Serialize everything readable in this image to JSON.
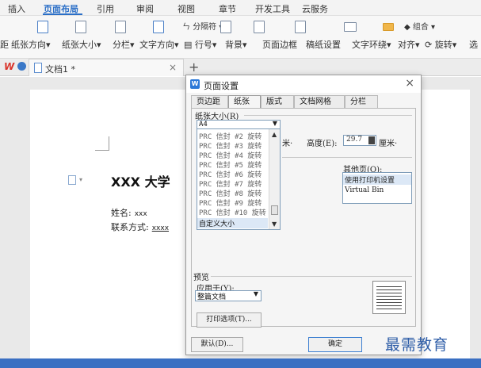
{
  "menu": {
    "tabs": [
      "插入",
      "页面布局",
      "引用",
      "审阅",
      "视图",
      "章节",
      "开发工具",
      "云服务"
    ],
    "active": "页面布局"
  },
  "ribbon": {
    "items": [
      "距",
      "纸张方向",
      "纸张大小",
      "分栏",
      "文字方向",
      "行号",
      "背景",
      "页面边框",
      "稿纸设置",
      "文字环绕",
      "对齐",
      "旋转",
      "选"
    ],
    "separator_label": "分隔符",
    "group_label": "组合"
  },
  "doc_tab": {
    "title": "文档1 *",
    "close": "×",
    "new": "+"
  },
  "document": {
    "title": "XXX 大学",
    "name_label": "姓名:",
    "name_value": "xxx",
    "contact_label": "联系方式:",
    "contact_value": "xxxx"
  },
  "dialog": {
    "title": "页面设置",
    "close": "×",
    "tabs": [
      "页边距",
      "纸张",
      "版式",
      "文档网格",
      "分栏"
    ],
    "active_tab": "纸张",
    "paper_size_label": "纸张大小(R)",
    "paper_size_value": "A4",
    "paper_options": [
      "PRC 信封 #2 旋转",
      "PRC 信封 #3 旋转",
      "PRC 信封 #4 旋转",
      "PRC 信封 #5 旋转",
      "PRC 信封 #6 旋转",
      "PRC 信封 #7 旋转",
      "PRC 信封 #8 旋转",
      "PRC 信封 #9 旋转",
      "PRC 信封 #10 旋转",
      "自定义大小"
    ],
    "paper_selected": "自定义大小",
    "width_unit_partial": "米·",
    "height_label": "高度(E):",
    "height_value": "29.7",
    "height_unit": "厘米·",
    "other_pages_label": "其他页(O):",
    "other_pages_options": [
      "使用打印机设置",
      "Virtual Bin"
    ],
    "other_pages_selected": "使用打印机设置",
    "preview_label": "预览",
    "apply_to_label": "应用于(Y):",
    "apply_to_value": "整篇文档",
    "print_options_button": "打印选项(T)...",
    "default_button": "默认(D)...",
    "ok_button": "确定"
  },
  "watermark": "最需教育",
  "colors": {
    "accent": "#2b6fc7",
    "dialog_bg": "#f5f5f5",
    "selection": "#dce8f6",
    "watermark": "#2f5ea8"
  }
}
